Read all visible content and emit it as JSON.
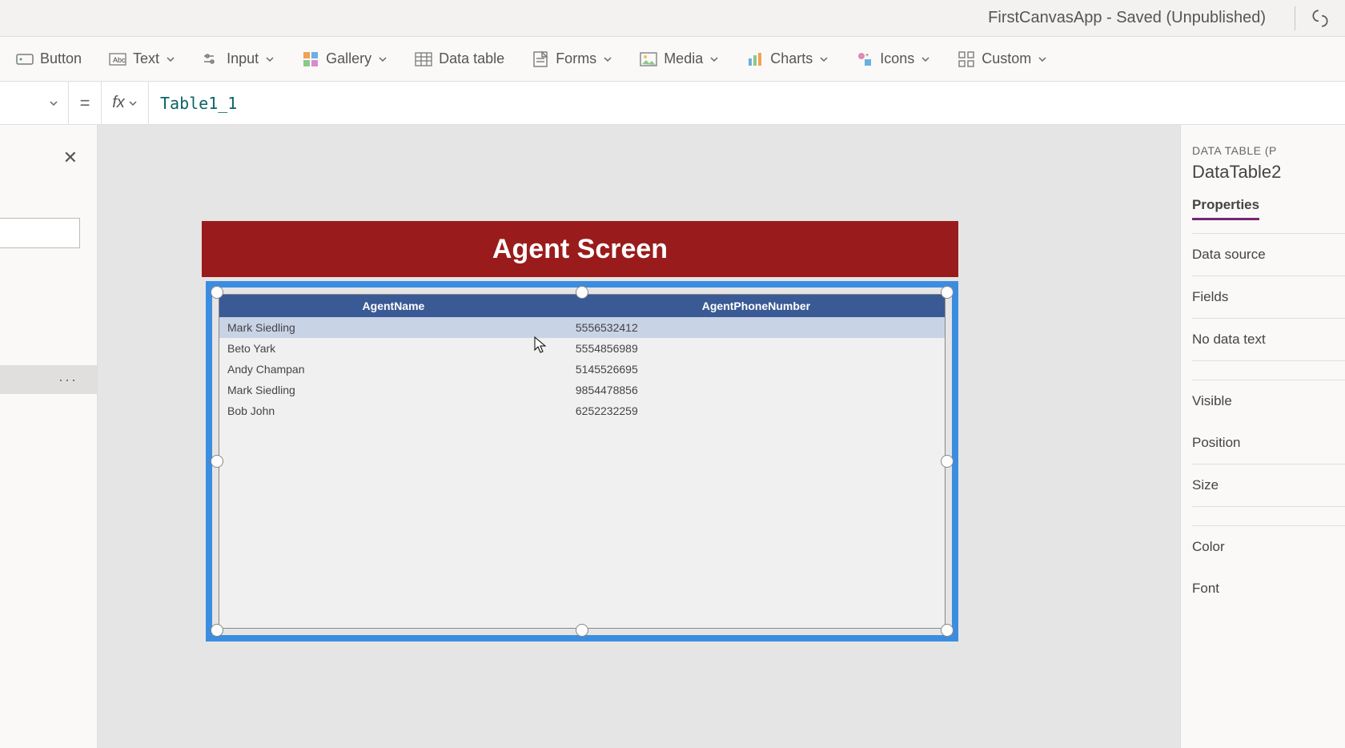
{
  "titlebar": {
    "title": "FirstCanvasApp - Saved (Unpublished)"
  },
  "ribbon": {
    "button": "Button",
    "text": "Text",
    "input": "Input",
    "gallery": "Gallery",
    "datatable": "Data table",
    "forms": "Forms",
    "media": "Media",
    "charts": "Charts",
    "icons": "Icons",
    "custom": "Custom"
  },
  "formula": {
    "eq": "=",
    "fx": "fx",
    "value": "Table1_1"
  },
  "leftpanel": {
    "more": "···"
  },
  "screen": {
    "title": "Agent Screen"
  },
  "datatable": {
    "columns": [
      "AgentName",
      "AgentPhoneNumber"
    ],
    "rows": [
      {
        "name": "Mark Siedling",
        "phone": "5556532412"
      },
      {
        "name": "Beto Yark",
        "phone": "5554856989"
      },
      {
        "name": "Andy Champan",
        "phone": "5145526695"
      },
      {
        "name": "Mark Siedling",
        "phone": "9854478856"
      },
      {
        "name": "Bob John",
        "phone": "6252232259"
      }
    ]
  },
  "rightpanel": {
    "ctype": "DATA TABLE (P",
    "cname": "DataTable2",
    "tab_properties": "Properties",
    "props": {
      "datasource": "Data source",
      "fields": "Fields",
      "nodata": "No data text",
      "visible": "Visible",
      "position": "Position",
      "size": "Size",
      "color": "Color",
      "font": "Font"
    }
  }
}
